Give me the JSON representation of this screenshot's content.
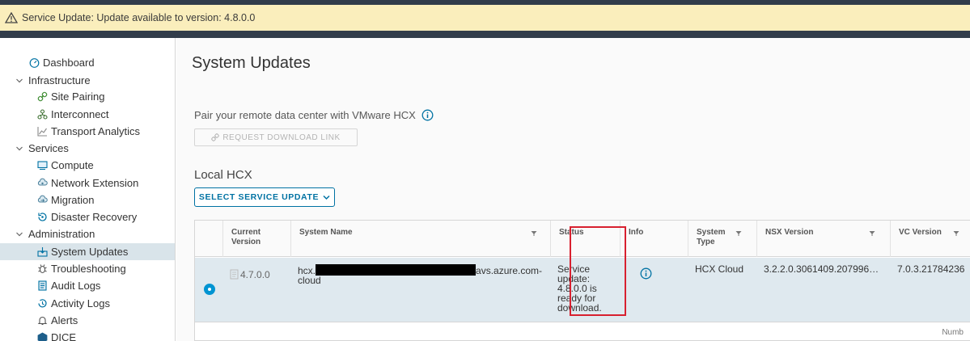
{
  "banner": {
    "text": "Service Update: Update available to version: 4.8.0.0",
    "icon": "warning-icon"
  },
  "sidebar": {
    "dashboard": "Dashboard",
    "infrastructure": "Infrastructure",
    "site_pairing": "Site Pairing",
    "interconnect": "Interconnect",
    "transport_analytics": "Transport Analytics",
    "services": "Services",
    "compute": "Compute",
    "network_extension": "Network Extension",
    "migration": "Migration",
    "disaster_recovery": "Disaster Recovery",
    "administration": "Administration",
    "system_updates": "System Updates",
    "troubleshooting": "Troubleshooting",
    "audit_logs": "Audit Logs",
    "activity_logs": "Activity Logs",
    "alerts": "Alerts",
    "dice": "DICE"
  },
  "main": {
    "title": "System Updates",
    "pair_text": "Pair your remote data center with VMware HCX",
    "request_button": "REQUEST DOWNLOAD LINK",
    "local_title": "Local HCX",
    "select_button": "SELECT SERVICE UPDATE"
  },
  "grid": {
    "headers": {
      "current_version": [
        "Current",
        "Version"
      ],
      "system_name": "System Name",
      "status": "Status",
      "info": "Info",
      "system_type": [
        "System",
        "Type"
      ],
      "nsx_version": "NSX Version",
      "vc_version": "VC Version"
    },
    "row": {
      "current_version": "4.7.0.0",
      "system_name_prefix": "hcx.",
      "system_name_suffix": "avs.azure.com-",
      "system_name_line2": "cloud",
      "status": [
        "Service",
        "update:",
        "4.8.0.0 is",
        "ready for",
        "download."
      ],
      "system_type": "HCX Cloud",
      "nsx_version": "3.2.2.0.3061409.207996…",
      "vc_version": "7.0.3.21784236"
    },
    "footer": "Numb"
  }
}
